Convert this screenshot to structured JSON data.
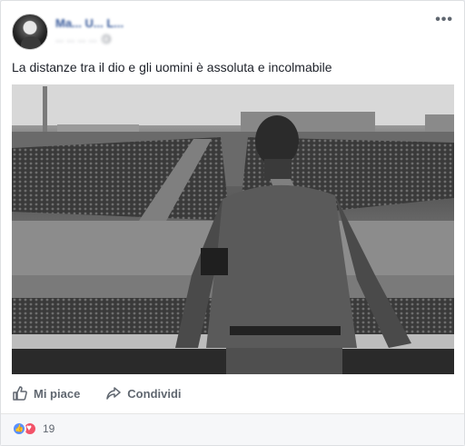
{
  "post": {
    "author": "Ma... U... L...",
    "meta": "... ... ... ...",
    "text": "La distanze tra il dio e gli uomini è assoluta e incolmabile",
    "options_icon": "more-horizontal-icon"
  },
  "actions": {
    "like_label": "Mi piace",
    "share_label": "Condividi"
  },
  "reactions": {
    "count": "19",
    "types": [
      "like",
      "love"
    ]
  },
  "colors": {
    "link_blue": "#365899",
    "like_blue": "#5890ff",
    "love_red": "#f25268",
    "meta_gray": "#90949c"
  }
}
